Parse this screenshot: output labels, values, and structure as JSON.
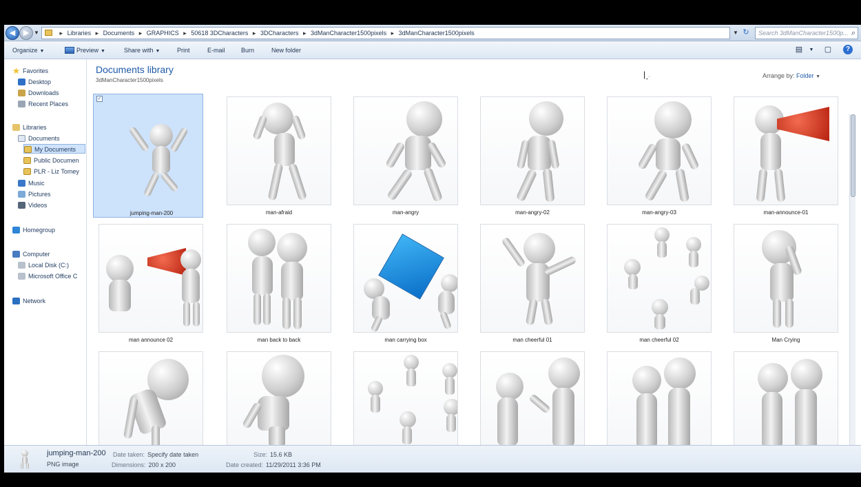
{
  "address": {
    "crumbs": [
      "Libraries",
      "Documents",
      "GRAPHICS",
      "50618 3DCharacters",
      "3DCharacters",
      "3dManCharacter1500pixels",
      "3dManCharacter1500pixels"
    ],
    "search_placeholder": "Search 3dManCharacter1500p..."
  },
  "toolbar": {
    "organize": "Organize",
    "preview": "Preview",
    "share_with": "Share with",
    "print": "Print",
    "email": "E-mail",
    "burn": "Burn",
    "new_folder": "New folder"
  },
  "nav": {
    "favorites": "Favorites",
    "desktop": "Desktop",
    "downloads": "Downloads",
    "recent_places": "Recent Places",
    "libraries": "Libraries",
    "documents": "Documents",
    "my_documents": "My Documents",
    "public_documents": "Public Documen",
    "plr": "PLR - Liz Tomey",
    "music": "Music",
    "pictures": "Pictures",
    "videos": "Videos",
    "homegroup": "Homegroup",
    "computer": "Computer",
    "local_disk": "Local Disk (C:)",
    "office": "Microsoft Office C",
    "network": "Network"
  },
  "main": {
    "title": "Documents library",
    "subtitle": "3dManCharacter1500pixels",
    "arrange_label": "Arrange by:",
    "arrange_value": "Folder"
  },
  "files": [
    "jumping-man-200",
    "man-afraid",
    "man-angry",
    "man-angry-02",
    "man-angry-03",
    "man-announce-01",
    "man announce 02",
    "man back to back",
    "man carrying box",
    "man cheerful 01",
    "man cheerful 02",
    "Man Crying",
    "",
    "",
    "",
    "",
    "",
    ""
  ],
  "details": {
    "name": "jumping-man-200",
    "type": "PNG image",
    "date_taken_label": "Date taken:",
    "date_taken_value": "Specify date taken",
    "dimensions_label": "Dimensions:",
    "dimensions_value": "200 x 200",
    "size_label": "Size:",
    "size_value": "15.6 KB",
    "created_label": "Date created:",
    "created_value": "11/29/2011 3:36 PM"
  },
  "colors": {
    "accent": "#1e5aa8",
    "selection": "#cde2fb",
    "megaphone": "#c8260f",
    "box": "#1a8fe0"
  }
}
